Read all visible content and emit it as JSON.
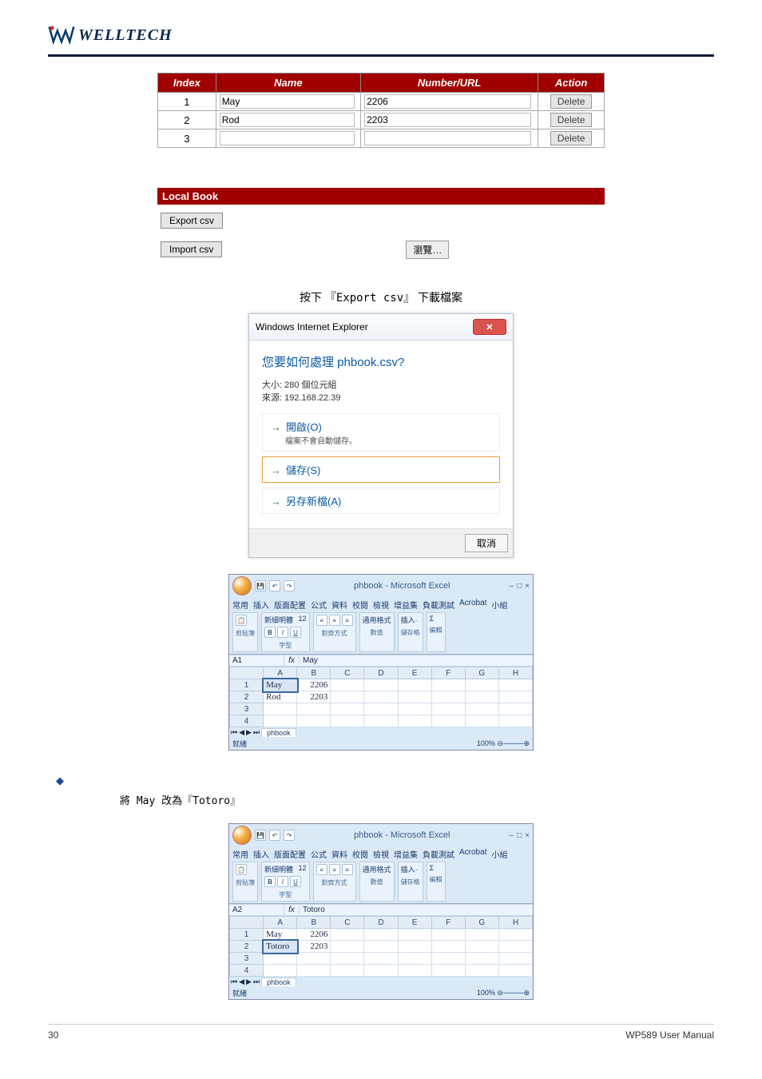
{
  "brand": "WELLTECH",
  "table": {
    "headers": [
      "Index",
      "Name",
      "Number/URL",
      "Action"
    ],
    "rows": [
      {
        "index": "1",
        "name": "May",
        "num": "2206",
        "action": "Delete"
      },
      {
        "index": "2",
        "name": "Rod",
        "num": "2203",
        "action": "Delete"
      },
      {
        "index": "3",
        "name": "",
        "num": "",
        "action": "Delete"
      }
    ]
  },
  "localbook": {
    "title": "Local Book",
    "export": "Export csv",
    "import": "Import csv",
    "browse": "瀏覽…"
  },
  "cap1": {
    "pre": "按下",
    "export": "『Export csv』",
    "post": "下載檔案"
  },
  "dialog": {
    "title": "Windows Internet Explorer",
    "question": "您要如何處理 phbook.csv?",
    "size": "大小: 280 個位元組",
    "source": "來源: 192.168.22.39",
    "open": "開啟(O)",
    "open_sub": "檔案不會自動儲存。",
    "save": "儲存(S)",
    "saveas": "另存新檔(A)",
    "cancel": "取消"
  },
  "excel1": {
    "win_title": "phbook - Microsoft Excel",
    "tabs": [
      "常用",
      "插入",
      "版面配置",
      "公式",
      "資料",
      "校閱",
      "檢視",
      "增益集",
      "負載測試",
      "Acrobat",
      "小組"
    ],
    "groups": [
      "剪貼簿",
      "字型",
      "對齊方式",
      "數值",
      "儲存格",
      "編輯"
    ],
    "font": "新細明體",
    "size": "12",
    "cellref": "A1",
    "fval": "May",
    "cols": [
      "",
      "A",
      "B",
      "C",
      "D",
      "E",
      "F",
      "G",
      "H"
    ],
    "rows": [
      [
        "1",
        "May",
        "2206",
        "",
        "",
        "",
        "",
        "",
        ""
      ],
      [
        "2",
        "Rod",
        "2203",
        "",
        "",
        "",
        "",
        "",
        ""
      ],
      [
        "3",
        "",
        "",
        "",
        "",
        "",
        "",
        "",
        ""
      ],
      [
        "4",
        "",
        "",
        "",
        "",
        "",
        "",
        "",
        ""
      ]
    ],
    "sheet": "phbook",
    "zoom": "100%",
    "status": "就緒"
  },
  "bullet": "◆",
  "bullet_line": "將 May 改為『Totoro』",
  "excel2": {
    "win_title": "phbook - Microsoft Excel",
    "tabs": [
      "常用",
      "插入",
      "版面配置",
      "公式",
      "資料",
      "校閱",
      "檢視",
      "增益集",
      "負載測試",
      "Acrobat",
      "小組"
    ],
    "groups": [
      "剪貼簿",
      "字型",
      "對齊方式",
      "數值",
      "儲存格",
      "編輯"
    ],
    "font": "新細明體",
    "size": "12",
    "cellref": "A2",
    "fval": "Totoro",
    "cols": [
      "",
      "A",
      "B",
      "C",
      "D",
      "E",
      "F",
      "G",
      "H"
    ],
    "rows": [
      [
        "1",
        "May",
        "2206",
        "",
        "",
        "",
        "",
        "",
        ""
      ],
      [
        "2",
        "Totoro",
        "2203",
        "",
        "",
        "",
        "",
        "",
        ""
      ],
      [
        "3",
        "",
        "",
        "",
        "",
        "",
        "",
        "",
        ""
      ],
      [
        "4",
        "",
        "",
        "",
        "",
        "",
        "",
        "",
        ""
      ]
    ],
    "sheet": "phbook",
    "zoom": "100%",
    "status": "就緒"
  },
  "footer": {
    "left": "30",
    "right": "WP589 User Manual"
  }
}
